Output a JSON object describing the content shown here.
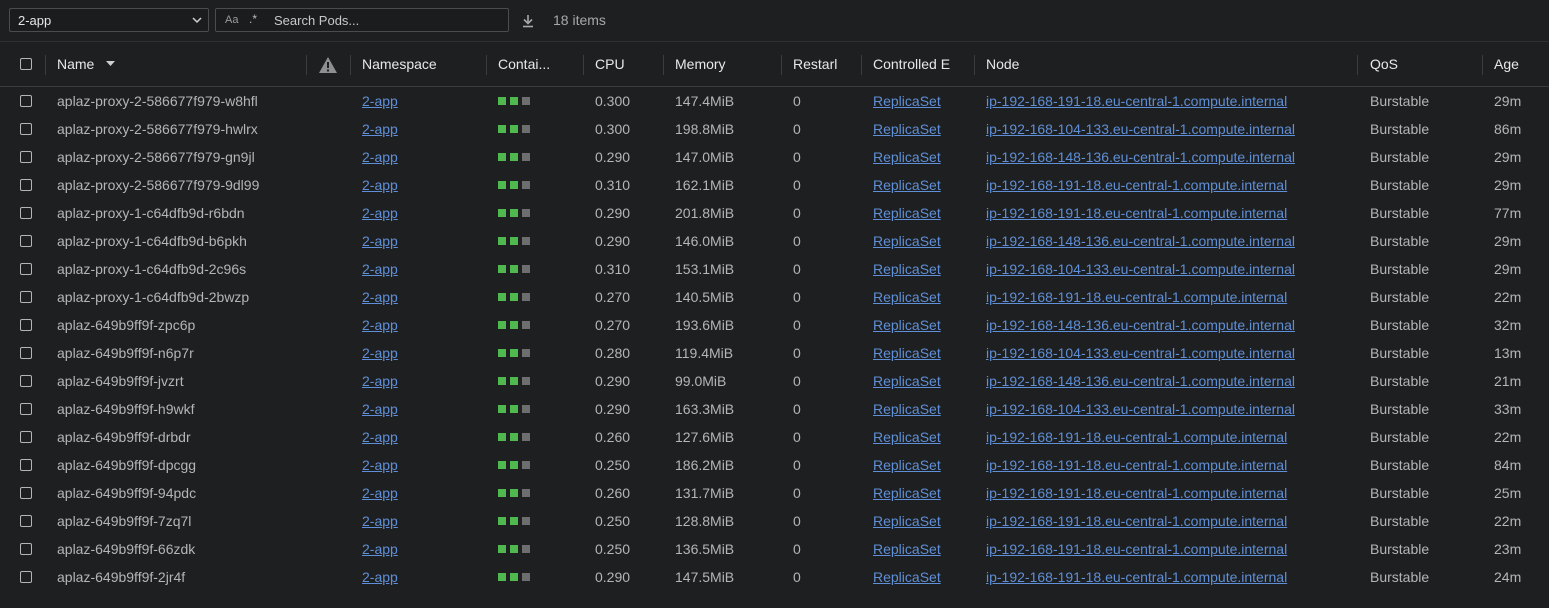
{
  "toolbar": {
    "namespace_value": "2-app",
    "regex_toggle": ".*",
    "match_case_toggle": "Aa",
    "search_placeholder": "Search Pods...",
    "items_count": "18 items"
  },
  "columns": [
    {
      "key": "name",
      "label": "Name"
    },
    {
      "key": "warnings",
      "label": ""
    },
    {
      "key": "namespace",
      "label": "Namespace"
    },
    {
      "key": "containers",
      "label": "Contai..."
    },
    {
      "key": "cpu",
      "label": "CPU"
    },
    {
      "key": "memory",
      "label": "Memory"
    },
    {
      "key": "restarts",
      "label": "Restarl"
    },
    {
      "key": "controlled_by",
      "label": "Controlled E"
    },
    {
      "key": "node",
      "label": "Node"
    },
    {
      "key": "qos",
      "label": "QoS"
    },
    {
      "key": "age",
      "label": "Age"
    }
  ],
  "colors": {
    "container_running": "#4fb84f",
    "container_other": "#6e6e6e",
    "link": "#5f8fd6"
  },
  "rows": [
    {
      "name": "aplaz-proxy-2-586677f979-w8hfl",
      "namespace": "2-app",
      "containers": [
        "running",
        "running",
        "other"
      ],
      "cpu": "0.300",
      "memory": "147.4MiB",
      "restarts": "0",
      "controlled_by": "ReplicaSet",
      "node": "ip-192-168-191-18.eu-central-1.compute.internal",
      "qos": "Burstable",
      "age": "29m"
    },
    {
      "name": "aplaz-proxy-2-586677f979-hwlrx",
      "namespace": "2-app",
      "containers": [
        "running",
        "running",
        "other"
      ],
      "cpu": "0.300",
      "memory": "198.8MiB",
      "restarts": "0",
      "controlled_by": "ReplicaSet",
      "node": "ip-192-168-104-133.eu-central-1.compute.internal",
      "qos": "Burstable",
      "age": "86m"
    },
    {
      "name": "aplaz-proxy-2-586677f979-gn9jl",
      "namespace": "2-app",
      "containers": [
        "running",
        "running",
        "other"
      ],
      "cpu": "0.290",
      "memory": "147.0MiB",
      "restarts": "0",
      "controlled_by": "ReplicaSet",
      "node": "ip-192-168-148-136.eu-central-1.compute.internal",
      "qos": "Burstable",
      "age": "29m"
    },
    {
      "name": "aplaz-proxy-2-586677f979-9dl99",
      "namespace": "2-app",
      "containers": [
        "running",
        "running",
        "other"
      ],
      "cpu": "0.310",
      "memory": "162.1MiB",
      "restarts": "0",
      "controlled_by": "ReplicaSet",
      "node": "ip-192-168-191-18.eu-central-1.compute.internal",
      "qos": "Burstable",
      "age": "29m"
    },
    {
      "name": "aplaz-proxy-1-c64dfb9d-r6bdn",
      "namespace": "2-app",
      "containers": [
        "running",
        "running",
        "other"
      ],
      "cpu": "0.290",
      "memory": "201.8MiB",
      "restarts": "0",
      "controlled_by": "ReplicaSet",
      "node": "ip-192-168-191-18.eu-central-1.compute.internal",
      "qos": "Burstable",
      "age": "77m"
    },
    {
      "name": "aplaz-proxy-1-c64dfb9d-b6pkh",
      "namespace": "2-app",
      "containers": [
        "running",
        "running",
        "other"
      ],
      "cpu": "0.290",
      "memory": "146.0MiB",
      "restarts": "0",
      "controlled_by": "ReplicaSet",
      "node": "ip-192-168-148-136.eu-central-1.compute.internal",
      "qos": "Burstable",
      "age": "29m"
    },
    {
      "name": "aplaz-proxy-1-c64dfb9d-2c96s",
      "namespace": "2-app",
      "containers": [
        "running",
        "running",
        "other"
      ],
      "cpu": "0.310",
      "memory": "153.1MiB",
      "restarts": "0",
      "controlled_by": "ReplicaSet",
      "node": "ip-192-168-104-133.eu-central-1.compute.internal",
      "qos": "Burstable",
      "age": "29m"
    },
    {
      "name": "aplaz-proxy-1-c64dfb9d-2bwzp",
      "namespace": "2-app",
      "containers": [
        "running",
        "running",
        "other"
      ],
      "cpu": "0.270",
      "memory": "140.5MiB",
      "restarts": "0",
      "controlled_by": "ReplicaSet",
      "node": "ip-192-168-191-18.eu-central-1.compute.internal",
      "qos": "Burstable",
      "age": "22m"
    },
    {
      "name": "aplaz-649b9ff9f-zpc6p",
      "namespace": "2-app",
      "containers": [
        "running",
        "running",
        "other"
      ],
      "cpu": "0.270",
      "memory": "193.6MiB",
      "restarts": "0",
      "controlled_by": "ReplicaSet",
      "node": "ip-192-168-148-136.eu-central-1.compute.internal",
      "qos": "Burstable",
      "age": "32m"
    },
    {
      "name": "aplaz-649b9ff9f-n6p7r",
      "namespace": "2-app",
      "containers": [
        "running",
        "running",
        "other"
      ],
      "cpu": "0.280",
      "memory": "119.4MiB",
      "restarts": "0",
      "controlled_by": "ReplicaSet",
      "node": "ip-192-168-104-133.eu-central-1.compute.internal",
      "qos": "Burstable",
      "age": "13m"
    },
    {
      "name": "aplaz-649b9ff9f-jvzrt",
      "namespace": "2-app",
      "containers": [
        "running",
        "running",
        "other"
      ],
      "cpu": "0.290",
      "memory": "99.0MiB",
      "restarts": "0",
      "controlled_by": "ReplicaSet",
      "node": "ip-192-168-148-136.eu-central-1.compute.internal",
      "qos": "Burstable",
      "age": "21m"
    },
    {
      "name": "aplaz-649b9ff9f-h9wkf",
      "namespace": "2-app",
      "containers": [
        "running",
        "running",
        "other"
      ],
      "cpu": "0.290",
      "memory": "163.3MiB",
      "restarts": "0",
      "controlled_by": "ReplicaSet",
      "node": "ip-192-168-104-133.eu-central-1.compute.internal",
      "qos": "Burstable",
      "age": "33m"
    },
    {
      "name": "aplaz-649b9ff9f-drbdr",
      "namespace": "2-app",
      "containers": [
        "running",
        "running",
        "other"
      ],
      "cpu": "0.260",
      "memory": "127.6MiB",
      "restarts": "0",
      "controlled_by": "ReplicaSet",
      "node": "ip-192-168-191-18.eu-central-1.compute.internal",
      "qos": "Burstable",
      "age": "22m"
    },
    {
      "name": "aplaz-649b9ff9f-dpcgg",
      "namespace": "2-app",
      "containers": [
        "running",
        "running",
        "other"
      ],
      "cpu": "0.250",
      "memory": "186.2MiB",
      "restarts": "0",
      "controlled_by": "ReplicaSet",
      "node": "ip-192-168-191-18.eu-central-1.compute.internal",
      "qos": "Burstable",
      "age": "84m"
    },
    {
      "name": "aplaz-649b9ff9f-94pdc",
      "namespace": "2-app",
      "containers": [
        "running",
        "running",
        "other"
      ],
      "cpu": "0.260",
      "memory": "131.7MiB",
      "restarts": "0",
      "controlled_by": "ReplicaSet",
      "node": "ip-192-168-191-18.eu-central-1.compute.internal",
      "qos": "Burstable",
      "age": "25m"
    },
    {
      "name": "aplaz-649b9ff9f-7zq7l",
      "namespace": "2-app",
      "containers": [
        "running",
        "running",
        "other"
      ],
      "cpu": "0.250",
      "memory": "128.8MiB",
      "restarts": "0",
      "controlled_by": "ReplicaSet",
      "node": "ip-192-168-191-18.eu-central-1.compute.internal",
      "qos": "Burstable",
      "age": "22m"
    },
    {
      "name": "aplaz-649b9ff9f-66zdk",
      "namespace": "2-app",
      "containers": [
        "running",
        "running",
        "other"
      ],
      "cpu": "0.250",
      "memory": "136.5MiB",
      "restarts": "0",
      "controlled_by": "ReplicaSet",
      "node": "ip-192-168-191-18.eu-central-1.compute.internal",
      "qos": "Burstable",
      "age": "23m"
    },
    {
      "name": "aplaz-649b9ff9f-2jr4f",
      "namespace": "2-app",
      "containers": [
        "running",
        "running",
        "other"
      ],
      "cpu": "0.290",
      "memory": "147.5MiB",
      "restarts": "0",
      "controlled_by": "ReplicaSet",
      "node": "ip-192-168-191-18.eu-central-1.compute.internal",
      "qos": "Burstable",
      "age": "24m"
    }
  ]
}
